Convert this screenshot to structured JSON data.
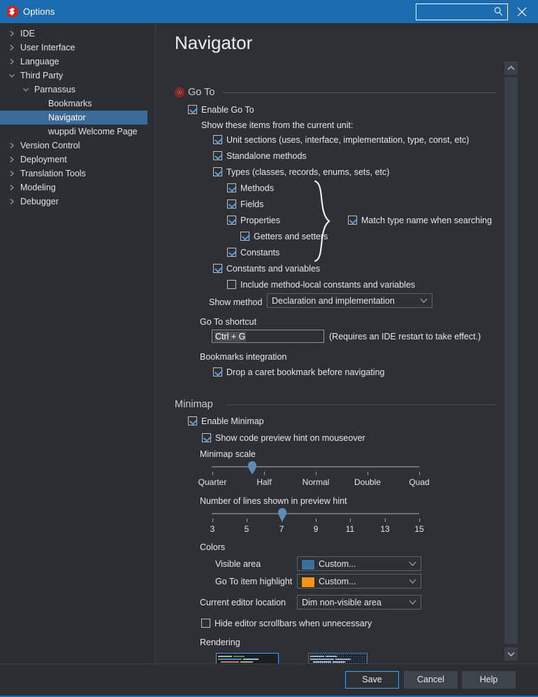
{
  "window": {
    "title": "Options",
    "app_icon": "parnassus-logo-icon",
    "search_placeholder": "",
    "search_value": "",
    "close_label": "✕"
  },
  "sidebar": {
    "items": [
      {
        "label": "IDE",
        "indent": 0,
        "arrow": "chevron-right",
        "selected": false
      },
      {
        "label": "User Interface",
        "indent": 0,
        "arrow": "chevron-right",
        "selected": false
      },
      {
        "label": "Language",
        "indent": 0,
        "arrow": "chevron-right",
        "selected": false
      },
      {
        "label": "Third Party",
        "indent": 0,
        "arrow": "chevron-down",
        "selected": false
      },
      {
        "label": "Parnassus",
        "indent": 1,
        "arrow": "chevron-down",
        "selected": false
      },
      {
        "label": "Bookmarks",
        "indent": 2,
        "arrow": "none",
        "selected": false
      },
      {
        "label": "Navigator",
        "indent": 2,
        "arrow": "none",
        "selected": true
      },
      {
        "label": "wuppdi Welcome Page",
        "indent": 2,
        "arrow": "none",
        "selected": false
      },
      {
        "label": "Version Control",
        "indent": 0,
        "arrow": "chevron-right",
        "selected": false
      },
      {
        "label": "Deployment",
        "indent": 0,
        "arrow": "chevron-right",
        "selected": false
      },
      {
        "label": "Translation Tools",
        "indent": 0,
        "arrow": "chevron-right",
        "selected": false
      },
      {
        "label": "Modeling",
        "indent": 0,
        "arrow": "chevron-right",
        "selected": false
      },
      {
        "label": "Debugger",
        "indent": 0,
        "arrow": "chevron-right",
        "selected": false
      }
    ]
  },
  "main": {
    "page_title": "Navigator",
    "goto": {
      "group_label": "Go To",
      "enable_label": "Enable Go To",
      "enable_checked": true,
      "show_items_label": "Show these items from the current unit:",
      "items": [
        {
          "label": "Unit sections (uses, interface, implementation, type, const, etc)",
          "checked": true
        },
        {
          "label": "Standalone methods",
          "checked": true
        },
        {
          "label": "Types (classes, records, enums, sets, etc)",
          "checked": true
        },
        {
          "label": "Methods",
          "checked": true
        },
        {
          "label": "Fields",
          "checked": true
        },
        {
          "label": "Properties",
          "checked": true
        },
        {
          "label": "Getters and setters",
          "checked": true
        },
        {
          "label": "Constants",
          "checked": true
        },
        {
          "label": "Constants and variables",
          "checked": true
        },
        {
          "label": "Include method-local constants and variables",
          "checked": false
        }
      ],
      "match_type_label": "Match type name when searching",
      "match_type_checked": true,
      "show_method_label": "Show method",
      "show_method_value": "Declaration and implementation",
      "shortcut_label": "Go To shortcut",
      "shortcut_value": "Ctrl + G",
      "shortcut_note": "(Requires an IDE restart to take effect.)",
      "bookmarks_label": "Bookmarks integration",
      "drop_bookmark_label": "Drop a caret bookmark before navigating",
      "drop_bookmark_checked": true
    },
    "minimap": {
      "group_label": "Minimap",
      "enable_label": "Enable Minimap",
      "enable_checked": true,
      "preview_hint_label": "Show code preview hint on mouseover",
      "preview_hint_checked": true,
      "scale_label": "Minimap scale",
      "scale_ticks": [
        "Quarter",
        "Half",
        "Normal",
        "Double",
        "Quad"
      ],
      "scale_value": "Half",
      "lines_label": "Number of lines shown in preview hint",
      "lines_ticks": [
        "3",
        "5",
        "7",
        "9",
        "11",
        "13",
        "15"
      ],
      "lines_value": "7",
      "colors_label": "Colors",
      "visible_area_label": "Visible area",
      "visible_area_value": "Custom...",
      "visible_area_color": "#3a6f9e",
      "goto_highlight_label": "Go To item highlight",
      "goto_highlight_value": "Custom...",
      "goto_highlight_color": "#f59413",
      "editor_location_label": "Current editor location",
      "editor_location_value": "Dim non-visible area",
      "hide_scrollbars_label": "Hide editor scrollbars when unnecessary",
      "hide_scrollbars_checked": false,
      "rendering_label": "Rendering"
    }
  },
  "footer": {
    "save_label": "Save",
    "cancel_label": "Cancel",
    "help_label": "Help"
  }
}
